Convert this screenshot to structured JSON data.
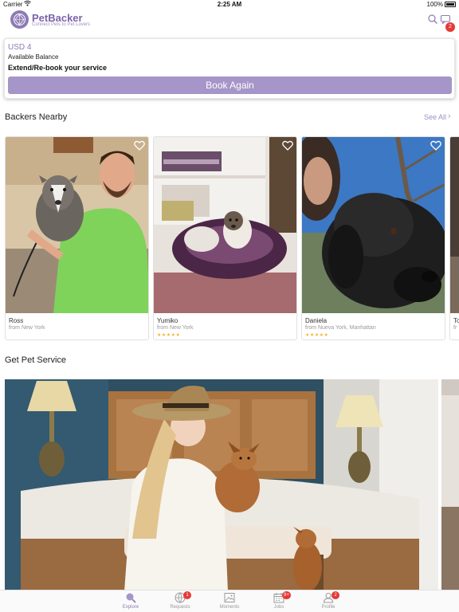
{
  "status_bar": {
    "carrier": "Carrier",
    "time": "2:25 AM",
    "battery": "100%"
  },
  "header": {
    "brand": "PetBacker",
    "tagline": "Connect Pets to Pet Lovers",
    "chat_badge": "2"
  },
  "balance": {
    "amount": "USD 4",
    "label": "Available Balance",
    "cta_text": "Extend/Re-book your service",
    "button": "Book Again"
  },
  "nearby": {
    "title": "Backers Nearby",
    "see_all": "See All",
    "backers": [
      {
        "name": "Ross",
        "location": "from New York",
        "rating": ""
      },
      {
        "name": "Yumiko",
        "location": "from New York",
        "rating": "★★★★★"
      },
      {
        "name": "Daniela",
        "location": "from Nueva York, Manhattan",
        "rating": "★★★★★"
      },
      {
        "name": "To",
        "location": "fr",
        "rating": ""
      }
    ]
  },
  "service": {
    "title": "Get Pet Service"
  },
  "tabs": [
    {
      "label": "Explore",
      "badge": ""
    },
    {
      "label": "Requests",
      "badge": "1"
    },
    {
      "label": "Moments",
      "badge": ""
    },
    {
      "label": "Jobs",
      "badge": "9+"
    },
    {
      "label": "Profile",
      "badge": "2"
    }
  ],
  "colors": {
    "brand": "#8e7ab5",
    "button": "#a695c8",
    "badge": "#e53935",
    "star": "#f2b630"
  }
}
